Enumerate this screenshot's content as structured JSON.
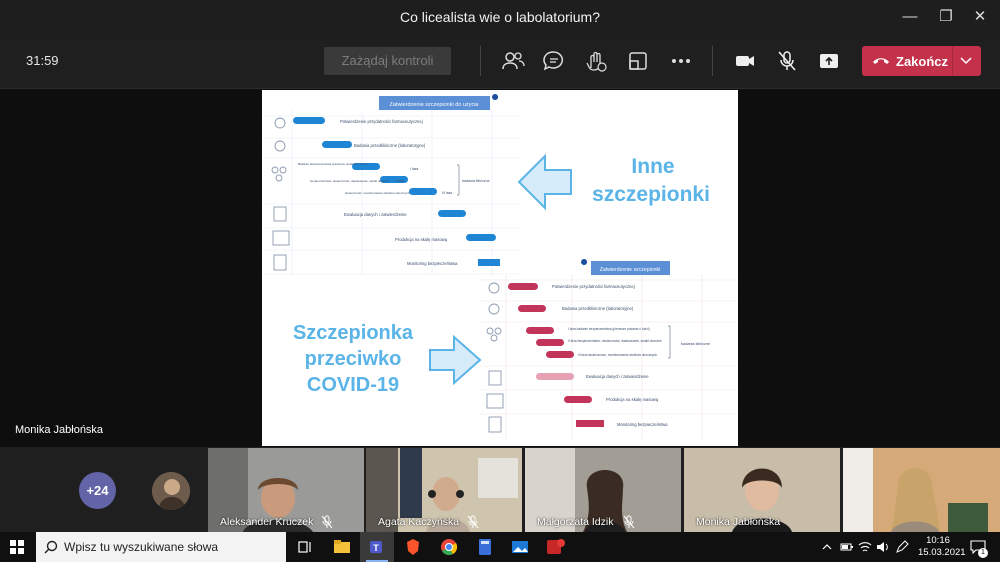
{
  "window": {
    "title": "Co licealista wie o labolatorium?"
  },
  "toolbar": {
    "timer": "31:59",
    "request_control_label": "Zażądaj kontroli",
    "end_label": "Zakończ"
  },
  "slide": {
    "top_chart": {
      "header": "Zatwierdzenie szczepionki do użycia",
      "rows": [
        "Potwierdzenie przydatności farmaceutycznej",
        "Badania przedkliniczne (laboratoryjne)",
        "Badanie bezpieczeństwa (pierwsze podanie u ludzi)",
        "I faza",
        "bezpieczeństwo, skuteczność, dawkowanie, skutki uboczne",
        "II faza",
        "skuteczność, monitorowanie skutków ubocznych",
        "III faza",
        "badania kliniczne",
        "Ewaluacja danych i zatwierdzenie",
        "Produkcja na skalę masową",
        "Monitoring bezpieczeństwa"
      ]
    },
    "bottom_chart": {
      "header": "Zatwierdzenie szczepionki",
      "rows": [
        "Potwierdzenie przydatności farmaceutycznej",
        "Badania przedkliniczne (laboratoryjne)",
        "I faza  badanie bezpieczeństwa (pierwsze podanie u ludzi)",
        "II faza  bezpieczeństwo, skuteczność, dawkowanie, skutki uboczne",
        "III faza  skuteczność, monitorowanie skutków ubocznych",
        "badania kliniczne",
        "Ewaluacja danych i zatwierdzenie",
        "Produkcja na skalę masową",
        "Monitoring bezpieczeństwa"
      ]
    },
    "label_other_line1": "Inne",
    "label_other_line2": "szczepionki",
    "label_covid_line1": "Szczepionka",
    "label_covid_line2": "przeciwko",
    "label_covid_line3": "COVID-19",
    "color_blue": "#1f86d6",
    "color_red": "#c3345a",
    "color_text_blue": "#5ab4e8"
  },
  "stage": {
    "speaker_name": "Monika Jabłońska"
  },
  "participants": {
    "overflow_count": "+24",
    "tiles": [
      {
        "name": "Aleksander Kruczek"
      },
      {
        "name": "Agata Kaczyńska"
      },
      {
        "name": "Małgorzata Idzik"
      },
      {
        "name": "Monika Jabłońska"
      },
      {
        "name": ""
      }
    ]
  },
  "taskbar": {
    "search_placeholder": "Wpisz tu wyszukiwane słowa",
    "time": "10:16",
    "date": "15.03.2021",
    "notification_count": "1"
  }
}
